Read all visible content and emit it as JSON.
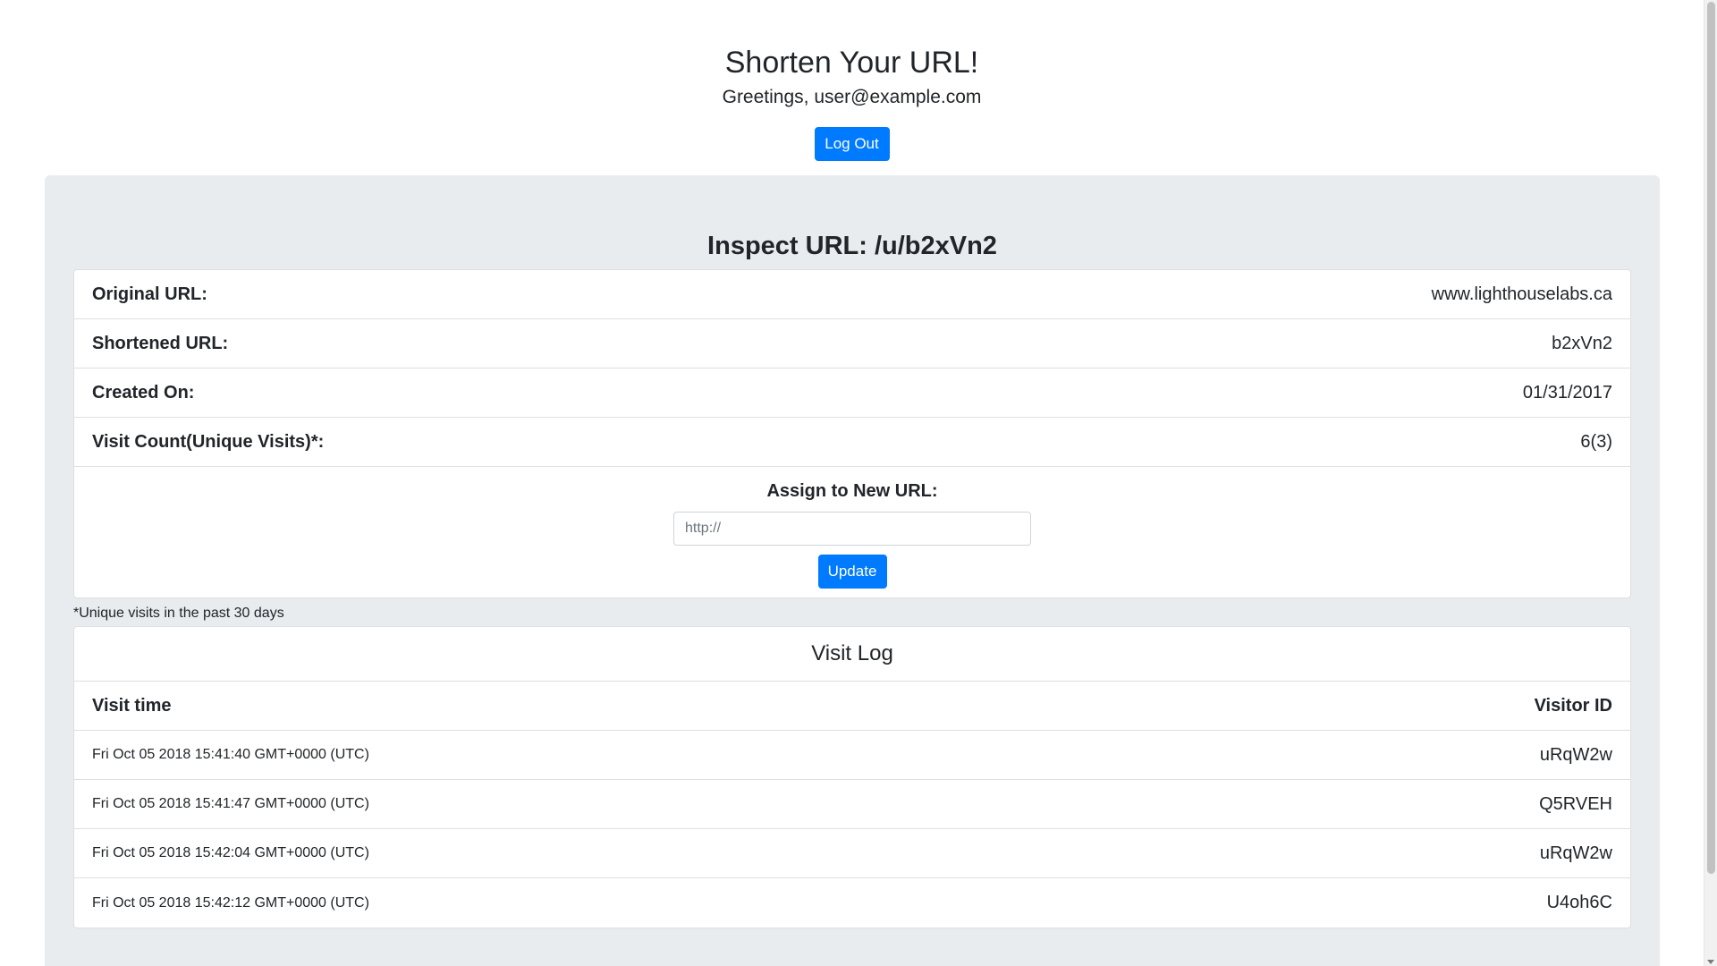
{
  "header": {
    "title": "Shorten Your URL!",
    "greeting": "Greetings, user@example.com",
    "logout_label": "Log Out"
  },
  "inspect": {
    "title": "Inspect URL: /u/b2xVn2",
    "details": [
      {
        "label": "Original URL:",
        "value": "www.lighthouselabs.ca"
      },
      {
        "label": "Shortened URL:",
        "value": "b2xVn2"
      },
      {
        "label": "Created On:",
        "value": "01/31/2017"
      },
      {
        "label": "Visit Count(Unique Visits)*:",
        "value": "6(3)"
      }
    ],
    "assign": {
      "label": "Assign to New URL:",
      "placeholder": "http://",
      "value": "",
      "update_label": "Update"
    },
    "footnote": "*Unique visits in the past 30 days"
  },
  "visit_log": {
    "title": "Visit Log",
    "columns": {
      "time": "Visit time",
      "visitor": "Visitor ID"
    },
    "rows": [
      {
        "time": "Fri Oct 05 2018 15:41:40 GMT+0000 (UTC)",
        "visitor": "uRqW2w"
      },
      {
        "time": "Fri Oct 05 2018 15:41:47 GMT+0000 (UTC)",
        "visitor": "Q5RVEH"
      },
      {
        "time": "Fri Oct 05 2018 15:42:04 GMT+0000 (UTC)",
        "visitor": "uRqW2w"
      },
      {
        "time": "Fri Oct 05 2018 15:42:12 GMT+0000 (UTC)",
        "visitor": "U4oh6C"
      }
    ]
  },
  "colors": {
    "primary": "#007bff",
    "jumbotron_bg": "#e9ecef",
    "text": "#212529"
  }
}
